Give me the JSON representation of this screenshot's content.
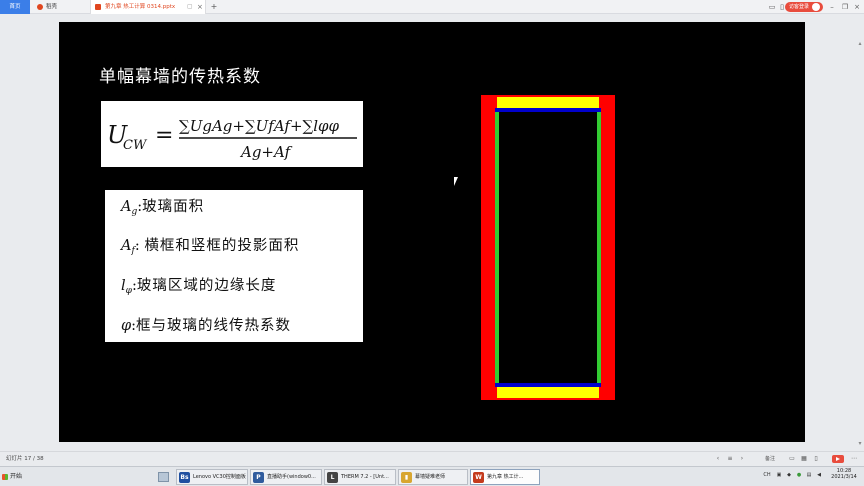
{
  "tabs": {
    "home": "首页",
    "wps": "稻壳",
    "doc": "第九章 热工计算 0314.pptx",
    "add": "+"
  },
  "account": {
    "login": "访客登录"
  },
  "slide": {
    "title": "单幅幕墙的传热系数",
    "formula": {
      "lhs": "U",
      "lhs_sub": "CW",
      "numerator": "∑UgAg+∑UfAf+∑lφφ",
      "denominator": "Ag+Af"
    },
    "definitions": [
      {
        "sym": "A",
        "sub": "g",
        "sep": ":",
        "text": "玻璃面积"
      },
      {
        "sym": "A",
        "sub": "f",
        "sep": ": ",
        "text": "横框和竖框的投影面积"
      },
      {
        "sym": "l",
        "sub": "φ",
        "sep": ":",
        "text": "玻璃区域的边缘长度"
      },
      {
        "sym": "φ",
        "sub": "",
        "sep": ":",
        "text": "框与玻璃的线传热系数"
      }
    ],
    "wall_colors": {
      "frame_side": "#ff0000",
      "frame_top": "#ffff00",
      "edge": "#0000cc",
      "glass_edge": "#33cc33",
      "glass": "#000000"
    }
  },
  "status": {
    "slide_counter": "幻灯片 17 / 38",
    "note": "备注"
  },
  "taskbar": {
    "start": "开始",
    "tasks": [
      {
        "label": "Lenovo VC30控制面板",
        "icon": "Bs",
        "color": "#1f4fa0"
      },
      {
        "label": "直播助手(window0...",
        "icon": "P",
        "color": "#2f5b9d"
      },
      {
        "label": "THERM 7.2 - [Unt...",
        "icon": "L",
        "color": "#444444"
      },
      {
        "label": "幕墙疑难老师",
        "icon": "▮",
        "color": "#d8a630"
      },
      {
        "label": "第九章 热工计...",
        "icon": "W",
        "color": "#c43b1d"
      }
    ],
    "tray_lang": "CH",
    "time": "10:28",
    "date": "2021/3/14"
  }
}
